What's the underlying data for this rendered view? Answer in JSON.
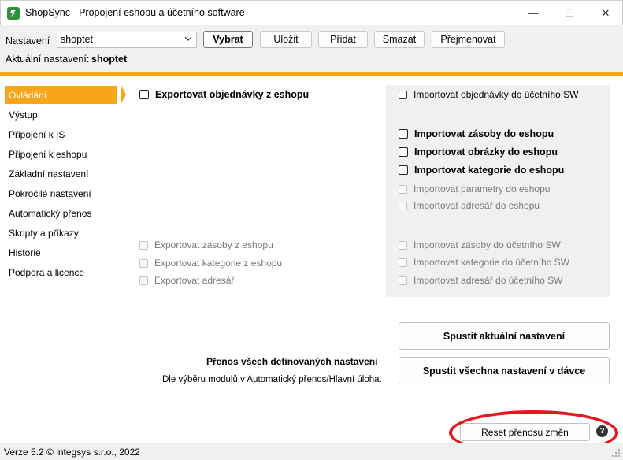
{
  "window": {
    "title": "ShopSync - Propojení eshopu a účetního software",
    "icon": "shopsync-logo-icon",
    "controls": {
      "minimize": "—",
      "maximize": "☐",
      "close": "✕"
    }
  },
  "toolbar": {
    "settings_label": "Nastavení",
    "settings_value": "shoptet",
    "buttons": {
      "select": "Vybrat",
      "save": "Uložit",
      "add": "Přidat",
      "delete": "Smazat",
      "rename": "Přejmenovat"
    },
    "current_label": "Aktuální nastavení:",
    "current_value": "shoptet"
  },
  "sidebar": {
    "items": [
      {
        "label": "Ovládání",
        "active": true
      },
      {
        "label": "Výstup"
      },
      {
        "label": "Připojení k IS"
      },
      {
        "label": "Připojení k eshopu"
      },
      {
        "label": "Základní nastavení"
      },
      {
        "label": "Pokročilé nastavení"
      },
      {
        "label": "Automatický přenos"
      },
      {
        "label": "Skripty a příkazy"
      },
      {
        "label": "Historie"
      },
      {
        "label": "Podpora a licence"
      }
    ]
  },
  "left_options": {
    "export_orders": "Exportovat objednávky z eshopu",
    "export_stock": "Exportovat zásoby z eshopu",
    "export_categories": "Exportovat kategorie z eshopu",
    "export_addresses": "Exportovat adresář"
  },
  "right_options": {
    "import_orders_sw": "Importovat objednávky do účetního SW",
    "import_stock_eshop": "Importovat zásoby do eshopu",
    "import_images_eshop": "Importovat obrázky do eshopu",
    "import_categories_eshop": "Importovat kategorie do eshopu",
    "import_params_eshop": "Importovat parametry do eshopu",
    "import_addresses_eshop": "Importovat adresář do eshopu",
    "import_stock_sw": "Importovat zásoby do účetního SW",
    "import_categories_sw": "Importovat kategorie do účetního SW",
    "import_addresses_sw": "Importovat adresář do účetního SW"
  },
  "actions": {
    "run_current": "Spustit aktuální nastavení",
    "run_all": "Spustit všechna nastavení v dávce",
    "transfer_title": "Přenos všech definovaných nastavení",
    "transfer_note": "Dle výběru modulů v Automatický přenos/Hlavní úloha.",
    "reset": "Reset přenosu změn",
    "help": "?"
  },
  "status": {
    "text": "Verze 5.2  © integsys s.r.o., 2022"
  },
  "colors": {
    "accent": "#f7a51b",
    "highlight_ellipse": "#e8151c",
    "panel_bg": "#f0f0f0"
  }
}
